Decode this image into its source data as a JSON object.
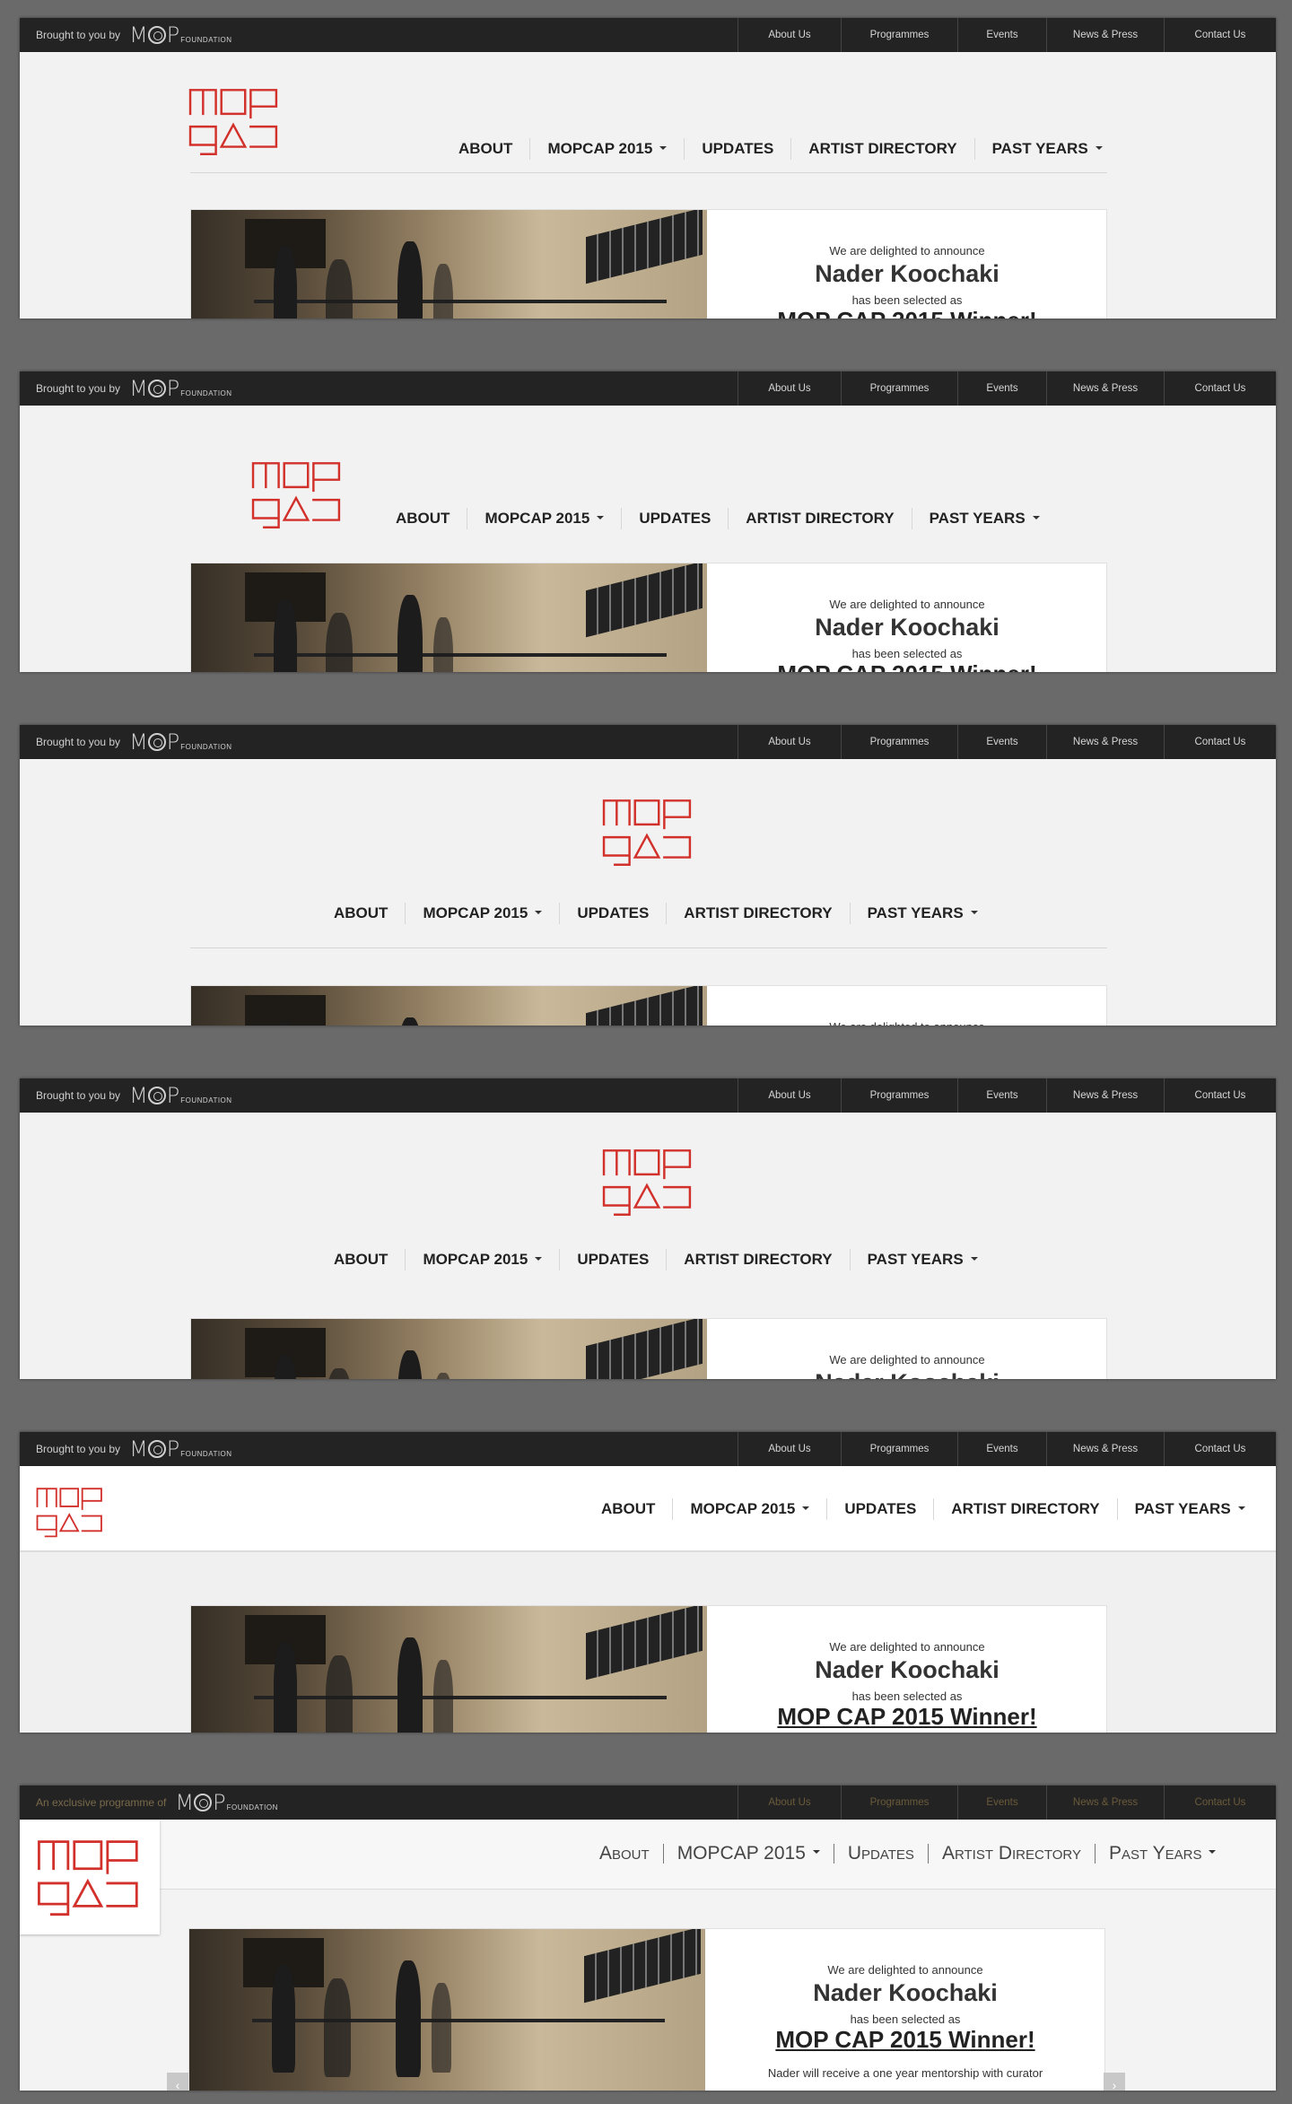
{
  "topbar": {
    "brought_text": "Brought to you by",
    "exclusive_text": "An exclusive programme of",
    "foundation_mark": "MOP",
    "foundation_word": "FOUNDATION",
    "menu": [
      "About Us",
      "Programmes",
      "Events",
      "News & Press",
      "Contact Us"
    ]
  },
  "logo": {
    "line1": "mop",
    "line2": "cap",
    "color": "#d2312b"
  },
  "nav": [
    "ABOUT",
    "MOPCAP 2015",
    "UPDATES",
    "ARTIST DIRECTORY",
    "PAST YEARS"
  ],
  "nav_light": [
    "About",
    "MOPCAP 2015",
    "Updates",
    "Artist Directory",
    "Past Years"
  ],
  "banner": {
    "line1": "We are delighted to announce",
    "name": "Nader Koochaki",
    "line2": "has been selected as",
    "winner": "MOP CAP 2015 Winner!",
    "desc": "Nader will receive a one year mentorship with curator"
  },
  "slider": {
    "prev": "‹",
    "next": "›"
  }
}
